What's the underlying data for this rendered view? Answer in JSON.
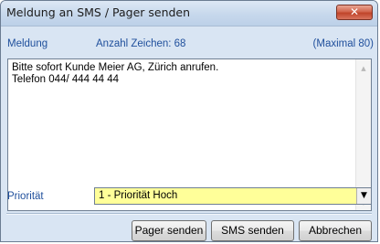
{
  "window": {
    "title": "Meldung an SMS / Pager senden",
    "close_glyph": "✕"
  },
  "message": {
    "label": "Meldung",
    "char_count_label": "Anzahl Zeichen: 68",
    "max_label": "(Maximal 80)",
    "text": "Bitte sofort Kunde Meier AG, Zürich anrufen.\nTelefon 044/ 444 44 44"
  },
  "priority": {
    "label": "Priorität",
    "selected": "1 - Priorität Hoch",
    "highlight_color": "#ffff99"
  },
  "buttons": {
    "pager": "Pager senden",
    "sms": "SMS senden",
    "cancel": "Abbrechen"
  },
  "colors": {
    "label_blue": "#1f4f9c",
    "close_red": "#c0442a",
    "window_bg": "#d9e5f3"
  }
}
